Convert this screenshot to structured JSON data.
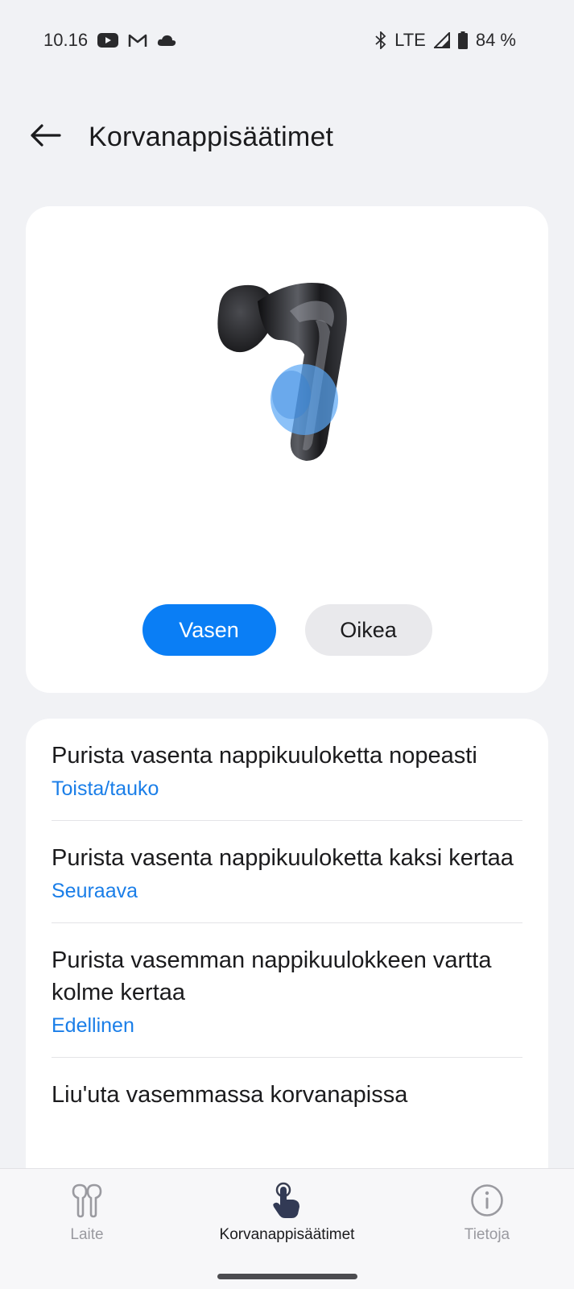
{
  "status_bar": {
    "time": "10.16",
    "network": "LTE",
    "battery": "84 %",
    "icons": [
      "youtube-icon",
      "gmail-icon",
      "cloud-icon",
      "bluetooth-icon",
      "signal-icon",
      "battery-icon"
    ]
  },
  "header": {
    "title": "Korvanappisäätimet",
    "back_icon": "arrow-left-icon"
  },
  "earbud_panel": {
    "image": "left-earbud-with-touch-area",
    "highlight_color": "#5aa6f5",
    "sides": [
      {
        "label": "Vasen",
        "selected": true
      },
      {
        "label": "Oikea",
        "selected": false
      }
    ]
  },
  "settings": [
    {
      "title": "Purista vasenta nappikuuloketta nopeasti",
      "value": "Toista/tauko"
    },
    {
      "title": "Purista vasenta nappikuuloketta kaksi kertaa",
      "value": "Seuraava"
    },
    {
      "title": "Purista vasemman nappikuulokkeen vartta kolme kertaa",
      "value": "Edellinen"
    },
    {
      "title": "Liu'uta vasemmassa korvanapissa",
      "value": ""
    }
  ],
  "bottom_nav": {
    "items": [
      {
        "label": "Laite",
        "icon": "earbuds-icon",
        "active": false
      },
      {
        "label": "Korvanappisäätimet",
        "icon": "touch-hand-icon",
        "active": true
      },
      {
        "label": "Tietoja",
        "icon": "info-icon",
        "active": false
      }
    ]
  },
  "colors": {
    "accent": "#0a7ef5",
    "link": "#1a7ee8",
    "background": "#f1f2f5",
    "card": "#ffffff"
  }
}
